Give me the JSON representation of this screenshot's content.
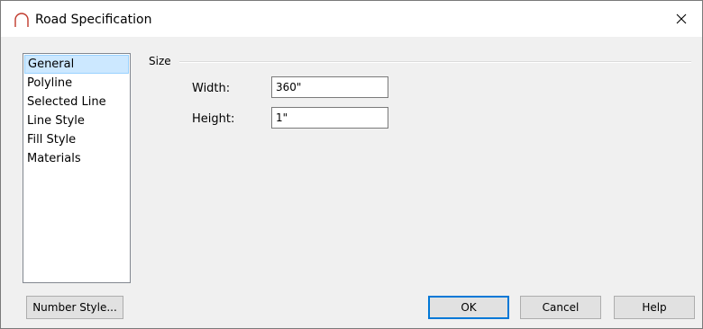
{
  "window": {
    "title": "Road Specification",
    "icon": "road-arc-icon",
    "close_glyph": "✕"
  },
  "nav": {
    "items": [
      {
        "label": "General",
        "selected": true
      },
      {
        "label": "Polyline",
        "selected": false
      },
      {
        "label": "Selected Line",
        "selected": false
      },
      {
        "label": "Line Style",
        "selected": false
      },
      {
        "label": "Fill Style",
        "selected": false
      },
      {
        "label": "Materials",
        "selected": false
      }
    ]
  },
  "size_group": {
    "label": "Size",
    "width_label": "Width:",
    "width_value": "360\"",
    "height_label": "Height:",
    "height_value": "1\""
  },
  "buttons": {
    "number_style": "Number Style...",
    "ok": "OK",
    "cancel": "Cancel",
    "help": "Help"
  },
  "colors": {
    "dialog_bg": "#f0f0f0",
    "selection_bg": "#cce8ff",
    "selection_border": "#99d1ff",
    "default_button_border": "#0078d7"
  }
}
